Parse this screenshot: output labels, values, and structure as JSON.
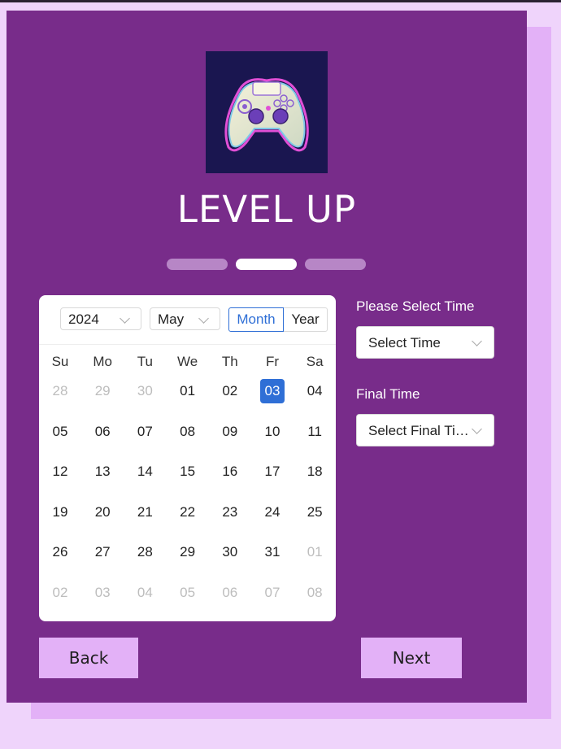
{
  "brand": {
    "title": "LEVEL UP",
    "logo_icon": "gamepad-icon"
  },
  "steps": {
    "count": 3,
    "active_index": 1
  },
  "calendar": {
    "year": "2024",
    "month": "May",
    "modes": [
      "Month",
      "Year"
    ],
    "active_mode": "Month",
    "weekdays": [
      "Su",
      "Mo",
      "Tu",
      "We",
      "Th",
      "Fr",
      "Sa"
    ],
    "weeks": [
      [
        {
          "d": "28",
          "m": true
        },
        {
          "d": "29",
          "m": true
        },
        {
          "d": "30",
          "m": true
        },
        {
          "d": "01"
        },
        {
          "d": "02"
        },
        {
          "d": "03",
          "sel": true
        },
        {
          "d": "04"
        }
      ],
      [
        {
          "d": "05"
        },
        {
          "d": "06"
        },
        {
          "d": "07"
        },
        {
          "d": "08"
        },
        {
          "d": "09"
        },
        {
          "d": "10"
        },
        {
          "d": "11"
        }
      ],
      [
        {
          "d": "12"
        },
        {
          "d": "13"
        },
        {
          "d": "14"
        },
        {
          "d": "15"
        },
        {
          "d": "16"
        },
        {
          "d": "17"
        },
        {
          "d": "18"
        }
      ],
      [
        {
          "d": "19"
        },
        {
          "d": "20"
        },
        {
          "d": "21"
        },
        {
          "d": "22"
        },
        {
          "d": "23"
        },
        {
          "d": "24"
        },
        {
          "d": "25"
        }
      ],
      [
        {
          "d": "26"
        },
        {
          "d": "27"
        },
        {
          "d": "28"
        },
        {
          "d": "29"
        },
        {
          "d": "30"
        },
        {
          "d": "31"
        },
        {
          "d": "01",
          "m": true
        }
      ],
      [
        {
          "d": "02",
          "m": true
        },
        {
          "d": "03",
          "m": true
        },
        {
          "d": "04",
          "m": true
        },
        {
          "d": "05",
          "m": true
        },
        {
          "d": "06",
          "m": true
        },
        {
          "d": "07",
          "m": true
        },
        {
          "d": "08",
          "m": true
        }
      ]
    ],
    "selected_day": "03"
  },
  "time": {
    "label": "Please Select Time",
    "placeholder": "Select Time"
  },
  "final_time": {
    "label": "Final Time",
    "placeholder": "Select Final Time"
  },
  "nav": {
    "back_label": "Back",
    "next_label": "Next"
  },
  "colors": {
    "panel": "#782c8a",
    "accent": "#2f6fd6",
    "button": "#e3b1f7",
    "background": "#efd4fb"
  }
}
